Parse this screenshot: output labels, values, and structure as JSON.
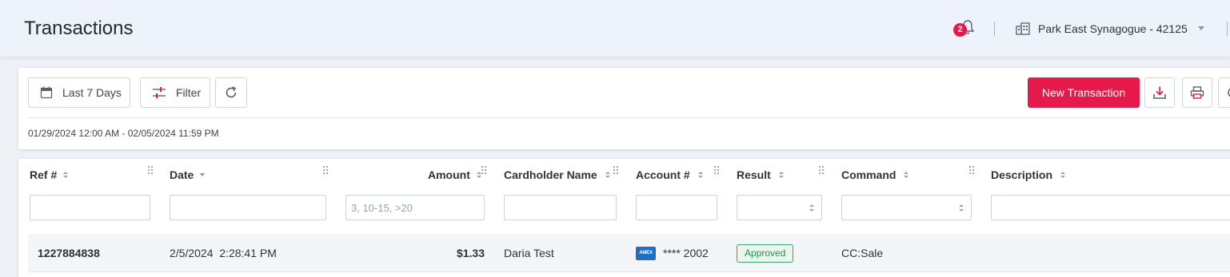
{
  "header": {
    "title": "Transactions",
    "notifications_count": "2",
    "organization": "Park East Synagogue - 42125"
  },
  "toolbar": {
    "date_preset_label": "Last 7 Days",
    "filter_label": "Filter",
    "new_transaction_label": "New Transaction",
    "date_range": "01/29/2024 12:00 AM - 02/05/2024 11:59 PM"
  },
  "table": {
    "columns": {
      "ref": "Ref #",
      "date": "Date",
      "amount": "Amount",
      "cardholder": "Cardholder Name",
      "account": "Account #",
      "result": "Result",
      "command": "Command",
      "description": "Description"
    },
    "amount_filter_placeholder": "3, 10-15, >20",
    "rows": [
      {
        "ref": "1227884838",
        "date": "2/5/2024  2:28:41 PM",
        "amount": "$1.33",
        "cardholder": "Daria Test",
        "card_brand": "AMEX",
        "account": "**** 2002",
        "result": "Approved",
        "command": "CC:Sale",
        "description": ""
      }
    ]
  },
  "colors": {
    "accent": "#e6194b",
    "approved": "#2d8a57",
    "header_bg": "#eef3fb"
  }
}
